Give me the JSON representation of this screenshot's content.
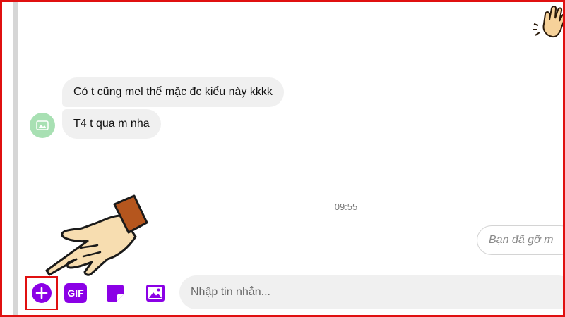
{
  "messages": [
    {
      "text": "Có t cũng mel thể mặc đc kiểu này kkkk"
    },
    {
      "text": "T4 t qua m nha"
    }
  ],
  "timestamp": "09:55",
  "recalled_message": "Bạn đã gỡ m",
  "toolbar": {
    "gif_label": "GIF",
    "input_placeholder": "Nhập tin nhắn..."
  },
  "colors": {
    "accent": "#8b00e6",
    "highlight": "#e01010",
    "bubble": "#f0f0f0",
    "avatar": "#a8e0b3"
  },
  "icons": [
    "plus-icon",
    "gif-icon",
    "sticker-icon",
    "image-icon",
    "pointing-hand-icon",
    "waving-hand-emoji"
  ]
}
